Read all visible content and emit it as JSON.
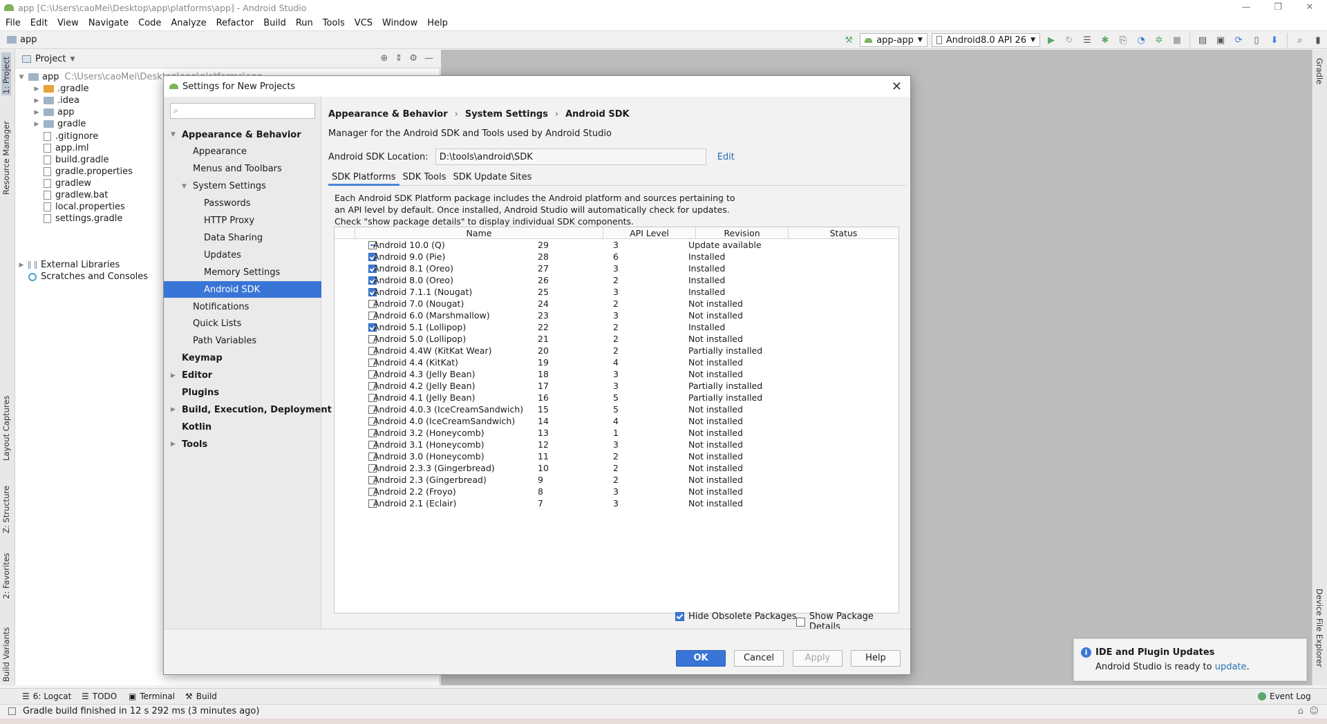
{
  "window": {
    "title": "app [C:\\Users\\caoMei\\Desktop\\app\\platforms\\app] - Android Studio",
    "controls": [
      "—",
      "❐",
      "✕"
    ]
  },
  "menu": [
    "File",
    "Edit",
    "View",
    "Navigate",
    "Code",
    "Analyze",
    "Refactor",
    "Build",
    "Run",
    "Tools",
    "VCS",
    "Window",
    "Help"
  ],
  "navbar": {
    "crumb": "app",
    "run_config": "app-app",
    "device": "Android8.0 API 26"
  },
  "left_strip": {
    "tabs": [
      "1: Project",
      "Resource Manager",
      "Layout Captures",
      "Z: Structure",
      "2: Favorites",
      "Build Variants"
    ]
  },
  "right_strip": {
    "tabs": [
      "Gradle",
      "Device File Explorer"
    ]
  },
  "project": {
    "header": "Project",
    "root": {
      "name": "app",
      "path": "C:\\Users\\caoMei\\Desktop\\app\\platforms\\app"
    },
    "items": [
      {
        "name": ".gradle",
        "kind": "folder-orange",
        "arrow": "▶"
      },
      {
        "name": ".idea",
        "kind": "folder",
        "arrow": "▶"
      },
      {
        "name": "app",
        "kind": "folder",
        "arrow": "▶"
      },
      {
        "name": "gradle",
        "kind": "folder",
        "arrow": "▶"
      },
      {
        "name": ".gitignore",
        "kind": "file",
        "arrow": ""
      },
      {
        "name": "app.iml",
        "kind": "file",
        "arrow": ""
      },
      {
        "name": "build.gradle",
        "kind": "file",
        "arrow": ""
      },
      {
        "name": "gradle.properties",
        "kind": "file",
        "arrow": ""
      },
      {
        "name": "gradlew",
        "kind": "file",
        "arrow": ""
      },
      {
        "name": "gradlew.bat",
        "kind": "file",
        "arrow": ""
      },
      {
        "name": "local.properties",
        "kind": "file",
        "arrow": ""
      },
      {
        "name": "settings.gradle",
        "kind": "file",
        "arrow": ""
      }
    ],
    "external": "External Libraries",
    "scratches": "Scratches and Consoles"
  },
  "dialog": {
    "title": "Settings for New Projects",
    "search_placeholder": "",
    "nav": [
      {
        "label": "Appearance & Behavior",
        "level": 0,
        "bold": true,
        "arrow": "▼"
      },
      {
        "label": "Appearance",
        "level": 1
      },
      {
        "label": "Menus and Toolbars",
        "level": 1
      },
      {
        "label": "System Settings",
        "level": 1,
        "arrow": "▼"
      },
      {
        "label": "Passwords",
        "level": 2
      },
      {
        "label": "HTTP Proxy",
        "level": 2
      },
      {
        "label": "Data Sharing",
        "level": 2
      },
      {
        "label": "Updates",
        "level": 2
      },
      {
        "label": "Memory Settings",
        "level": 2
      },
      {
        "label": "Android SDK",
        "level": 2,
        "selected": true
      },
      {
        "label": "Notifications",
        "level": 1
      },
      {
        "label": "Quick Lists",
        "level": 1
      },
      {
        "label": "Path Variables",
        "level": 1
      },
      {
        "label": "Keymap",
        "level": 0,
        "bold": true
      },
      {
        "label": "Editor",
        "level": 0,
        "bold": true,
        "arrow": "▶"
      },
      {
        "label": "Plugins",
        "level": 0,
        "bold": true
      },
      {
        "label": "Build, Execution, Deployment",
        "level": 0,
        "bold": true,
        "arrow": "▶"
      },
      {
        "label": "Kotlin",
        "level": 0,
        "bold": true
      },
      {
        "label": "Tools",
        "level": 0,
        "bold": true,
        "arrow": "▶"
      }
    ],
    "breadcrumb": [
      "Appearance & Behavior",
      "System Settings",
      "Android SDK"
    ],
    "description": "Manager for the Android SDK and Tools used by Android Studio",
    "sdk_location_label": "Android SDK Location:",
    "sdk_location": "D:\\tools\\android\\SDK",
    "edit_link": "Edit",
    "tabs": [
      "SDK Platforms",
      "SDK Tools",
      "SDK Update Sites"
    ],
    "platforms_desc": "Each Android SDK Platform package includes the Android platform and sources pertaining to an API level by default. Once installed, Android Studio will automatically check for updates. Check \"show package details\" to display individual SDK components.",
    "columns": [
      "Name",
      "API Level",
      "Revision",
      "Status"
    ],
    "rows": [
      {
        "check": "partial",
        "name": "Android 10.0 (Q)",
        "api": "29",
        "rev": "3",
        "status": "Update available"
      },
      {
        "check": "on",
        "name": "Android 9.0 (Pie)",
        "api": "28",
        "rev": "6",
        "status": "Installed"
      },
      {
        "check": "on",
        "name": "Android 8.1 (Oreo)",
        "api": "27",
        "rev": "3",
        "status": "Installed"
      },
      {
        "check": "on",
        "name": "Android 8.0 (Oreo)",
        "api": "26",
        "rev": "2",
        "status": "Installed"
      },
      {
        "check": "on",
        "name": "Android 7.1.1 (Nougat)",
        "api": "25",
        "rev": "3",
        "status": "Installed"
      },
      {
        "check": "off",
        "name": "Android 7.0 (Nougat)",
        "api": "24",
        "rev": "2",
        "status": "Not installed"
      },
      {
        "check": "off",
        "name": "Android 6.0 (Marshmallow)",
        "api": "23",
        "rev": "3",
        "status": "Not installed"
      },
      {
        "check": "on",
        "name": "Android 5.1 (Lollipop)",
        "api": "22",
        "rev": "2",
        "status": "Installed"
      },
      {
        "check": "off",
        "name": "Android 5.0 (Lollipop)",
        "api": "21",
        "rev": "2",
        "status": "Not installed"
      },
      {
        "check": "off",
        "name": "Android 4.4W (KitKat Wear)",
        "api": "20",
        "rev": "2",
        "status": "Partially installed"
      },
      {
        "check": "off",
        "name": "Android 4.4 (KitKat)",
        "api": "19",
        "rev": "4",
        "status": "Not installed"
      },
      {
        "check": "off",
        "name": "Android 4.3 (Jelly Bean)",
        "api": "18",
        "rev": "3",
        "status": "Not installed"
      },
      {
        "check": "off",
        "name": "Android 4.2 (Jelly Bean)",
        "api": "17",
        "rev": "3",
        "status": "Partially installed"
      },
      {
        "check": "off",
        "name": "Android 4.1 (Jelly Bean)",
        "api": "16",
        "rev": "5",
        "status": "Partially installed"
      },
      {
        "check": "off",
        "name": "Android 4.0.3 (IceCreamSandwich)",
        "api": "15",
        "rev": "5",
        "status": "Not installed"
      },
      {
        "check": "off",
        "name": "Android 4.0 (IceCreamSandwich)",
        "api": "14",
        "rev": "4",
        "status": "Not installed"
      },
      {
        "check": "off",
        "name": "Android 3.2 (Honeycomb)",
        "api": "13",
        "rev": "1",
        "status": "Not installed"
      },
      {
        "check": "off",
        "name": "Android 3.1 (Honeycomb)",
        "api": "12",
        "rev": "3",
        "status": "Not installed"
      },
      {
        "check": "off",
        "name": "Android 3.0 (Honeycomb)",
        "api": "11",
        "rev": "2",
        "status": "Not installed"
      },
      {
        "check": "off",
        "name": "Android 2.3.3 (Gingerbread)",
        "api": "10",
        "rev": "2",
        "status": "Not installed"
      },
      {
        "check": "off",
        "name": "Android 2.3 (Gingerbread)",
        "api": "9",
        "rev": "2",
        "status": "Not installed"
      },
      {
        "check": "off",
        "name": "Android 2.2 (Froyo)",
        "api": "8",
        "rev": "3",
        "status": "Not installed"
      },
      {
        "check": "off",
        "name": "Android 2.1 (Eclair)",
        "api": "7",
        "rev": "3",
        "status": "Not installed"
      }
    ],
    "hide_obsolete": "Hide Obsolete Packages",
    "show_details": "Show Package Details",
    "buttons": {
      "ok": "OK",
      "cancel": "Cancel",
      "apply": "Apply",
      "help": "Help"
    }
  },
  "notification": {
    "title": "IDE and Plugin Updates",
    "body": "Android Studio is ready to",
    "link": "update",
    "suffix": "."
  },
  "bottom_tools": [
    "6: Logcat",
    "TODO",
    "Terminal",
    "Build"
  ],
  "event_log": "Event Log",
  "status": "Gradle build finished in 12 s 292 ms (3 minutes ago)",
  "colors": {
    "accent": "#3875d6",
    "link": "#2470b3",
    "run": "#59a869"
  }
}
